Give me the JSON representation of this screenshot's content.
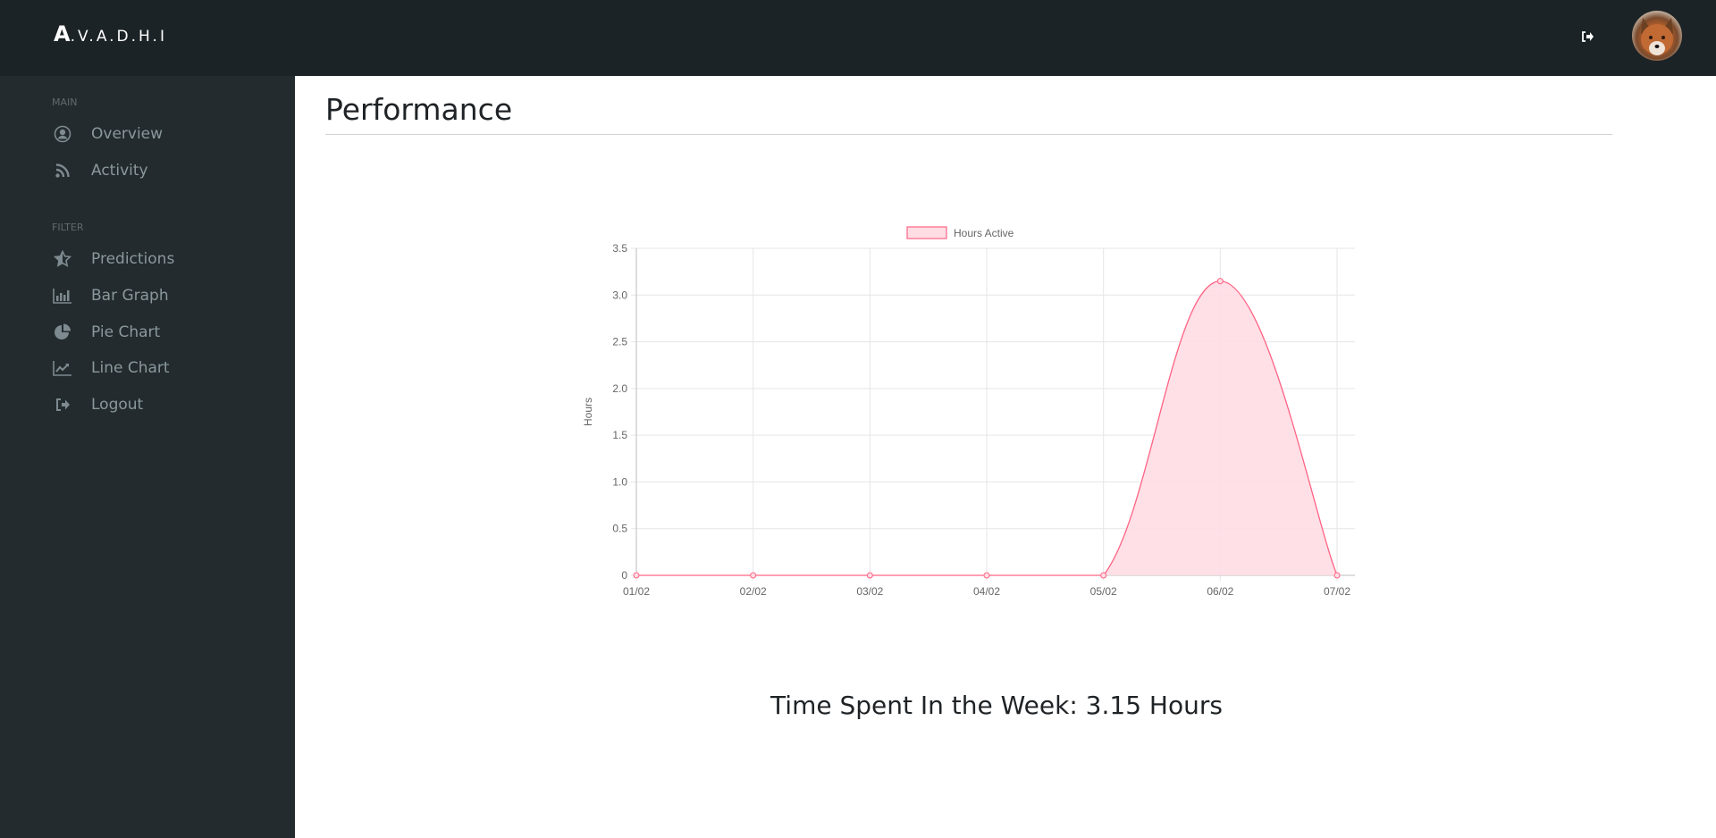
{
  "topbar": {
    "brand_initial": "A",
    "brand_rest": ".V.A.D.H.I",
    "logout_icon": "sign-out-icon",
    "avatar_alt": "fox avatar"
  },
  "sidebar": {
    "sections": [
      {
        "label": "MAIN",
        "items": [
          {
            "label": "Overview",
            "icon": "user-circle-icon"
          },
          {
            "label": "Activity",
            "icon": "rss-icon"
          }
        ]
      },
      {
        "label": "FILTER",
        "items": [
          {
            "label": "Predictions",
            "icon": "star-half-icon"
          },
          {
            "label": "Bar Graph",
            "icon": "bar-chart-icon"
          },
          {
            "label": "Pie Chart",
            "icon": "pie-chart-icon"
          },
          {
            "label": "Line Chart",
            "icon": "line-chart-icon"
          },
          {
            "label": "Logout",
            "icon": "sign-out-icon"
          }
        ]
      }
    ]
  },
  "main": {
    "title": "Performance",
    "summary": "Time Spent In the Week: 3.15 Hours"
  },
  "colors": {
    "line": "#ff6384",
    "fill": "#ffdde4",
    "grid": "#e6e6e6",
    "axis_text": "#666666"
  },
  "chart_data": {
    "type": "area",
    "title": "",
    "xlabel": "",
    "ylabel": "Hours",
    "categories": [
      "01/02",
      "02/02",
      "03/02",
      "04/02",
      "05/02",
      "06/02",
      "07/02"
    ],
    "series": [
      {
        "name": "Hours Active",
        "values": [
          0,
          0,
          0,
          0,
          0,
          3.15,
          0
        ]
      }
    ],
    "ylim": [
      0,
      3.5
    ],
    "yticks": [
      "0",
      "0.5",
      "1.0",
      "1.5",
      "2.0",
      "2.5",
      "3.0",
      "3.5"
    ],
    "grid": true,
    "legend": "top-center"
  }
}
